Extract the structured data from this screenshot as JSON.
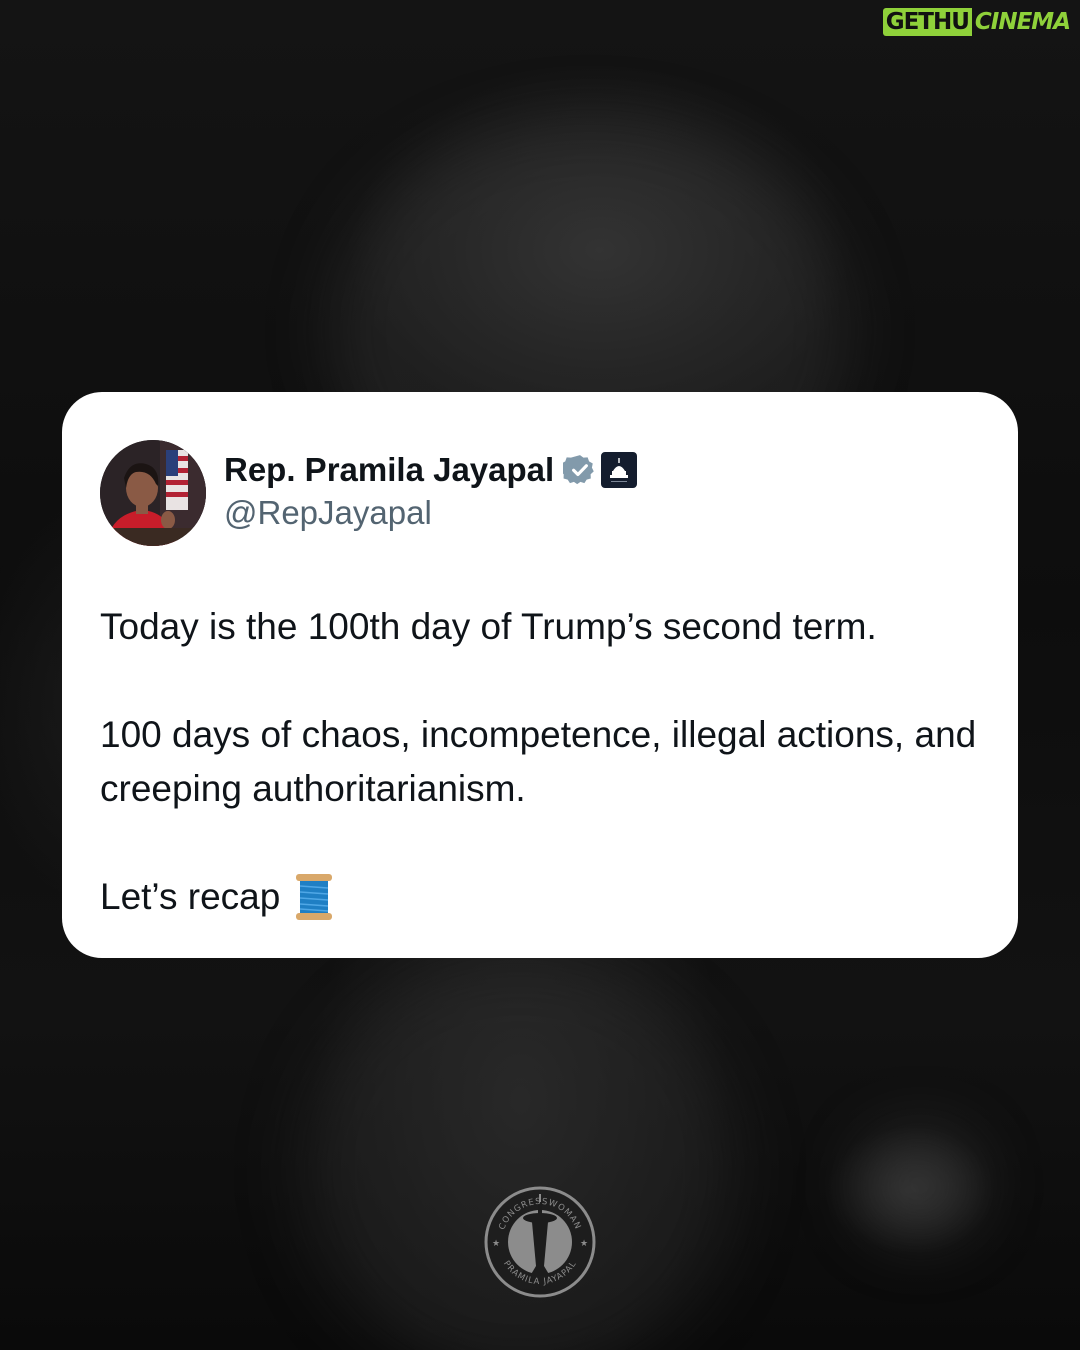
{
  "watermark": {
    "part_a": "GETHU",
    "part_b": "CINEMA",
    "accent_color": "#8fd13a"
  },
  "post": {
    "author_name": "Rep. Pramila Jayapal",
    "handle": "@RepJayapal",
    "verified_icon": "verified-badge-icon",
    "affiliation_icon": "capitol-badge-icon",
    "paragraphs": [
      "Today is the 100th day of Trump’s second term.",
      "100 days of chaos, incompetence, illegal actions, and creeping authoritarianism.",
      "Let’s recap"
    ],
    "thread_emoji_icon": "thread-spool-icon"
  },
  "seal": {
    "top_text": "CONGRESSWOMAN",
    "bottom_text": "PRAMILA JAYAPAL"
  },
  "colors": {
    "background": "#0b0b0b",
    "card": "#ffffff",
    "text_primary": "#0f1419",
    "text_secondary": "#536471",
    "verified_gray": "#829aab",
    "badge_navy": "#141d2e"
  }
}
